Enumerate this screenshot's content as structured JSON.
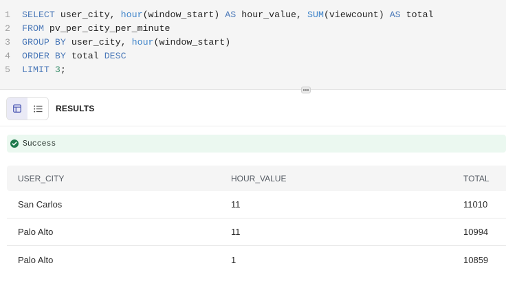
{
  "editor": {
    "lines": [
      {
        "num": "1",
        "tokens": [
          {
            "t": "SELECT",
            "k": "kw"
          },
          {
            "t": " user_city, "
          },
          {
            "t": "hour",
            "k": "fn"
          },
          {
            "t": "(window_start) "
          },
          {
            "t": "AS",
            "k": "kw"
          },
          {
            "t": " hour_value, "
          },
          {
            "t": "SUM",
            "k": "fn"
          },
          {
            "t": "(viewcount) "
          },
          {
            "t": "AS",
            "k": "kw"
          },
          {
            "t": " total"
          }
        ]
      },
      {
        "num": "2",
        "tokens": [
          {
            "t": "FROM",
            "k": "kw"
          },
          {
            "t": " pv_per_city_per_minute"
          }
        ]
      },
      {
        "num": "3",
        "tokens": [
          {
            "t": "GROUP BY",
            "k": "kw"
          },
          {
            "t": " user_city, "
          },
          {
            "t": "hour",
            "k": "fn"
          },
          {
            "t": "(window_start)"
          }
        ]
      },
      {
        "num": "4",
        "tokens": [
          {
            "t": "ORDER BY",
            "k": "kw"
          },
          {
            "t": " total "
          },
          {
            "t": "DESC",
            "k": "kw"
          }
        ]
      },
      {
        "num": "5",
        "tokens": [
          {
            "t": "LIMIT",
            "k": "kw"
          },
          {
            "t": " "
          },
          {
            "t": "3",
            "k": "num"
          },
          {
            "t": ";"
          }
        ]
      }
    ]
  },
  "results": {
    "title": "RESULTS",
    "view_modes": [
      {
        "name": "table-view",
        "icon": "table-icon",
        "active": true
      },
      {
        "name": "list-view",
        "icon": "list-icon",
        "active": false
      }
    ]
  },
  "status": {
    "text": "Success",
    "icon": "check-circle-icon",
    "color": "#1f7a4d"
  },
  "table": {
    "columns": [
      "USER_CITY",
      "HOUR_VALUE",
      "TOTAL"
    ],
    "rows": [
      [
        "San Carlos",
        "11",
        "11010"
      ],
      [
        "Palo Alto",
        "11",
        "10994"
      ],
      [
        "Palo Alto",
        "1",
        "10859"
      ]
    ]
  },
  "colors": {
    "keyword": "#4a78b8",
    "active_toggle": "#eaeaf6",
    "success_bg": "#ebf8f0"
  }
}
